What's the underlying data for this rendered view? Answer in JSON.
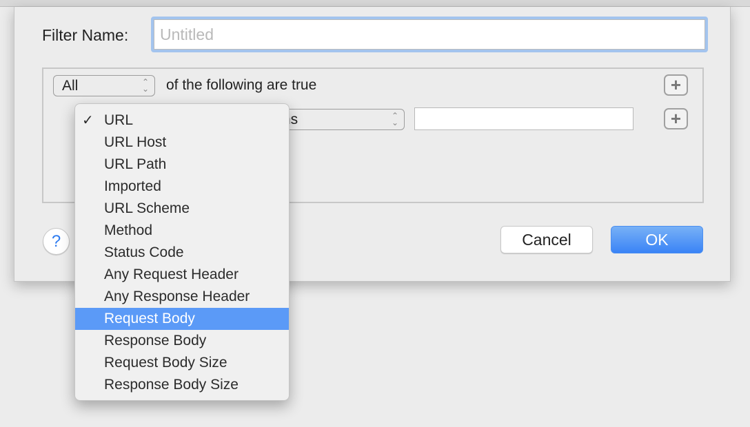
{
  "dialog": {
    "filter_name_label": "Filter Name:",
    "filter_name_placeholder": "Untitled",
    "match_select": "All",
    "match_suffix": "of the following are true",
    "condition_operator_visible": "ns",
    "add_icon": "plus",
    "help_label": "?",
    "cancel_label": "Cancel",
    "ok_label": "OK",
    "accent_color": "#3a83f6"
  },
  "menu": {
    "checked": "URL",
    "highlighted": "Request Body",
    "items": [
      "URL",
      "URL Host",
      "URL Path",
      "Imported",
      "URL Scheme",
      "Method",
      "Status Code",
      "Any Request Header",
      "Any Response Header",
      "Request Body",
      "Response Body",
      "Request Body Size",
      "Response Body Size"
    ]
  }
}
